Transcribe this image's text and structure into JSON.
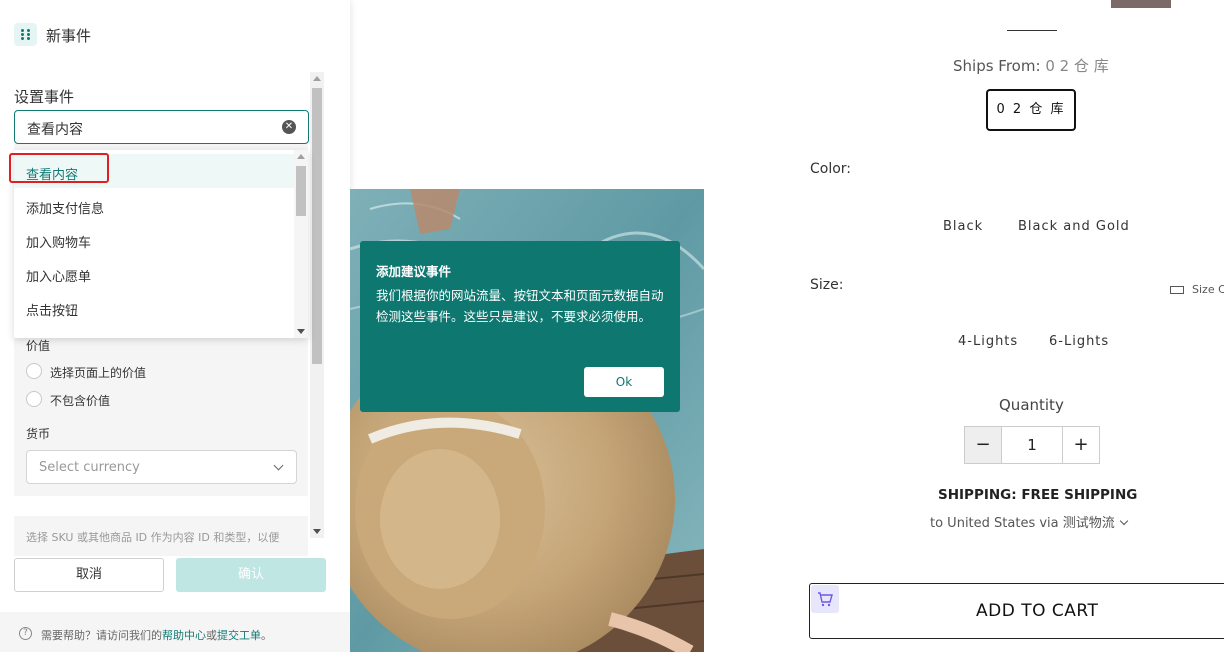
{
  "panel": {
    "title": "新事件",
    "section_label": "设置事件",
    "event_input_value": "查看内容",
    "dropdown_options": [
      "查看内容",
      "添加支付信息",
      "加入购物车",
      "加入心愿单",
      "点击按钮"
    ],
    "value_label": "价值",
    "radio_options": [
      "选择页面上的价值",
      "不包含价值"
    ],
    "currency_label": "货币",
    "currency_placeholder": "Select currency",
    "hint_text": "选择 SKU 或其他商品 ID 作为内容 ID 和类型，以便",
    "cancel_label": "取消",
    "confirm_label": "确认",
    "footer_text_before": "需要帮助？请访问我们的",
    "footer_link_help": "帮助中心",
    "footer_text_or": "或",
    "footer_link_ticket": "提交工单",
    "footer_text_end": "。"
  },
  "tooltip": {
    "title": "添加建议事件",
    "body": "我们根据你的网站流量、按钮文本和页面元数据自动检测这些事件。这些只是建议，不要求必须使用。",
    "ok_label": "Ok"
  },
  "product": {
    "ships_from_label": "Ships From:",
    "ships_from_value": "0 2 仓 库",
    "warehouse_option": "0 2 仓 库",
    "color_label": "Color:",
    "colors": [
      "Black",
      "Black and Gold"
    ],
    "size_label": "Size:",
    "size_guide_label": "Size C",
    "sizes": [
      "4-Lights",
      "6-Lights"
    ],
    "quantity_label": "Quantity",
    "quantity_value": "1",
    "qty_minus": "−",
    "qty_plus": "+",
    "shipping_title": "SHIPPING: FREE SHIPPING",
    "shipping_sub": "to United States via 测试物流",
    "add_to_cart_label": "ADD TO CART"
  },
  "colors": {
    "accent": "#127a74",
    "tooltip_bg": "#0e7770",
    "confirm_disabled": "#bfe6e3",
    "highlight": "#e02020"
  }
}
